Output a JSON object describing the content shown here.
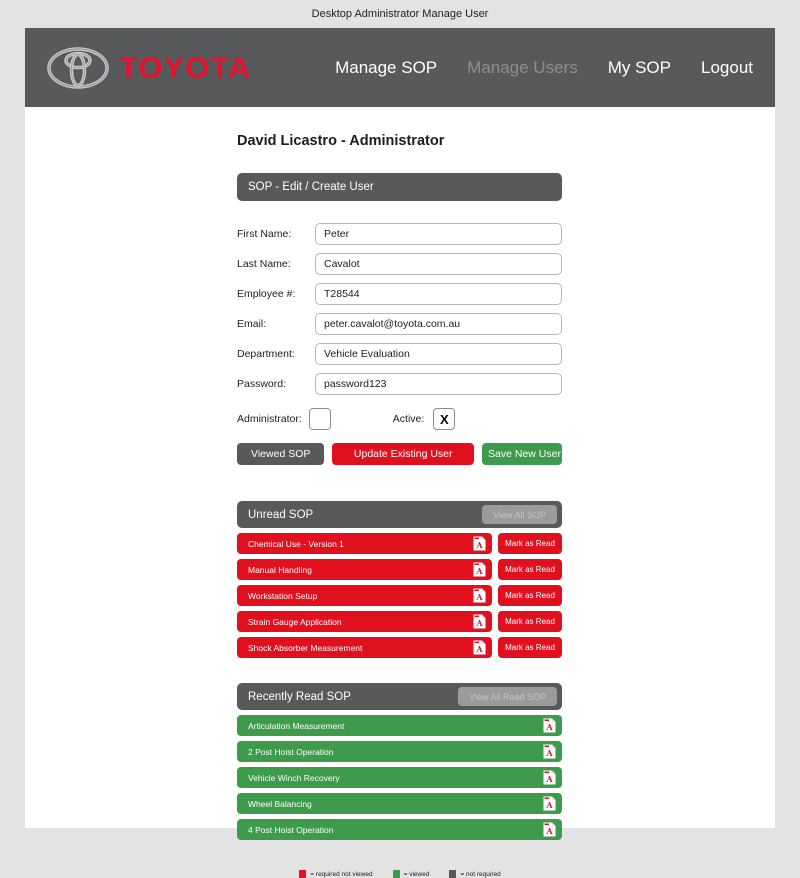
{
  "window": {
    "title": "Desktop Administrator Manage User"
  },
  "header": {
    "brand_name": "TOYOTA",
    "logo_icon": "toyota-logo-icon",
    "nav": [
      {
        "label": "Manage SOP",
        "current": false
      },
      {
        "label": "Manage Users",
        "current": true
      },
      {
        "label": "My SOP",
        "current": false
      },
      {
        "label": "Logout",
        "current": false
      }
    ]
  },
  "main": {
    "user_heading": "David Licastro - Administrator",
    "form_panel": {
      "title": "SOP - Edit / Create User",
      "fields": [
        {
          "label": "First Name:",
          "value": "Peter",
          "placeholder": "First Name"
        },
        {
          "label": "Last Name:",
          "value": "Cavalot",
          "placeholder": "Last Name"
        },
        {
          "label": "Employee #:",
          "value": "T28544",
          "placeholder": "Employee #"
        },
        {
          "label": "Email:",
          "value": "peter.cavalot@toyota.com.au",
          "placeholder": "Email"
        },
        {
          "label": "Department:",
          "value": "Vehicle Evaluation",
          "placeholder": "Department"
        },
        {
          "label": "Password:",
          "value": "password123",
          "placeholder": "Password"
        }
      ],
      "administrator_label": "Administrator:",
      "administrator_checked": "",
      "active_label": "Active:",
      "active_checked": "X",
      "buttons": {
        "viewed_sop": "Viewed SOP",
        "update_existing_user": "Update Existing User",
        "save_new_user": "Save New User"
      }
    },
    "unread_panel": {
      "title": "Unread SOP",
      "view_all_label": "View All SOP",
      "mark_read_label": "Mark as Read",
      "pdf_icon": "pdf-file-icon",
      "items": [
        {
          "name": "Chemical Use - Version 1"
        },
        {
          "name": "Manual Handling"
        },
        {
          "name": "Workstation Setup"
        },
        {
          "name": "Strain Gauge Application"
        },
        {
          "name": "Shock Absorber Measurement"
        }
      ]
    },
    "read_panel": {
      "title": "Recently Read SOP",
      "view_all_label": "View All Read SOP",
      "pdf_icon": "pdf-file-icon",
      "items": [
        {
          "name": "Articulation Measurement"
        },
        {
          "name": "2 Post Hoist Operation"
        },
        {
          "name": "Vehicle Winch Recovery"
        },
        {
          "name": "Wheel Balancing"
        },
        {
          "name": "4 Post Hoist Operation"
        }
      ]
    },
    "legend": [
      {
        "color": "#e1101f",
        "label": "= required not viewed"
      },
      {
        "color": "#3d9b4b",
        "label": "= viewed"
      },
      {
        "color": "#58595b",
        "label": "= not required"
      }
    ]
  },
  "colors": {
    "brand_red": "#e8112d",
    "header_grey": "#58595b",
    "status_red": "#e1101f",
    "status_green": "#3d9b4b",
    "page_background": "#e3e3e3"
  }
}
